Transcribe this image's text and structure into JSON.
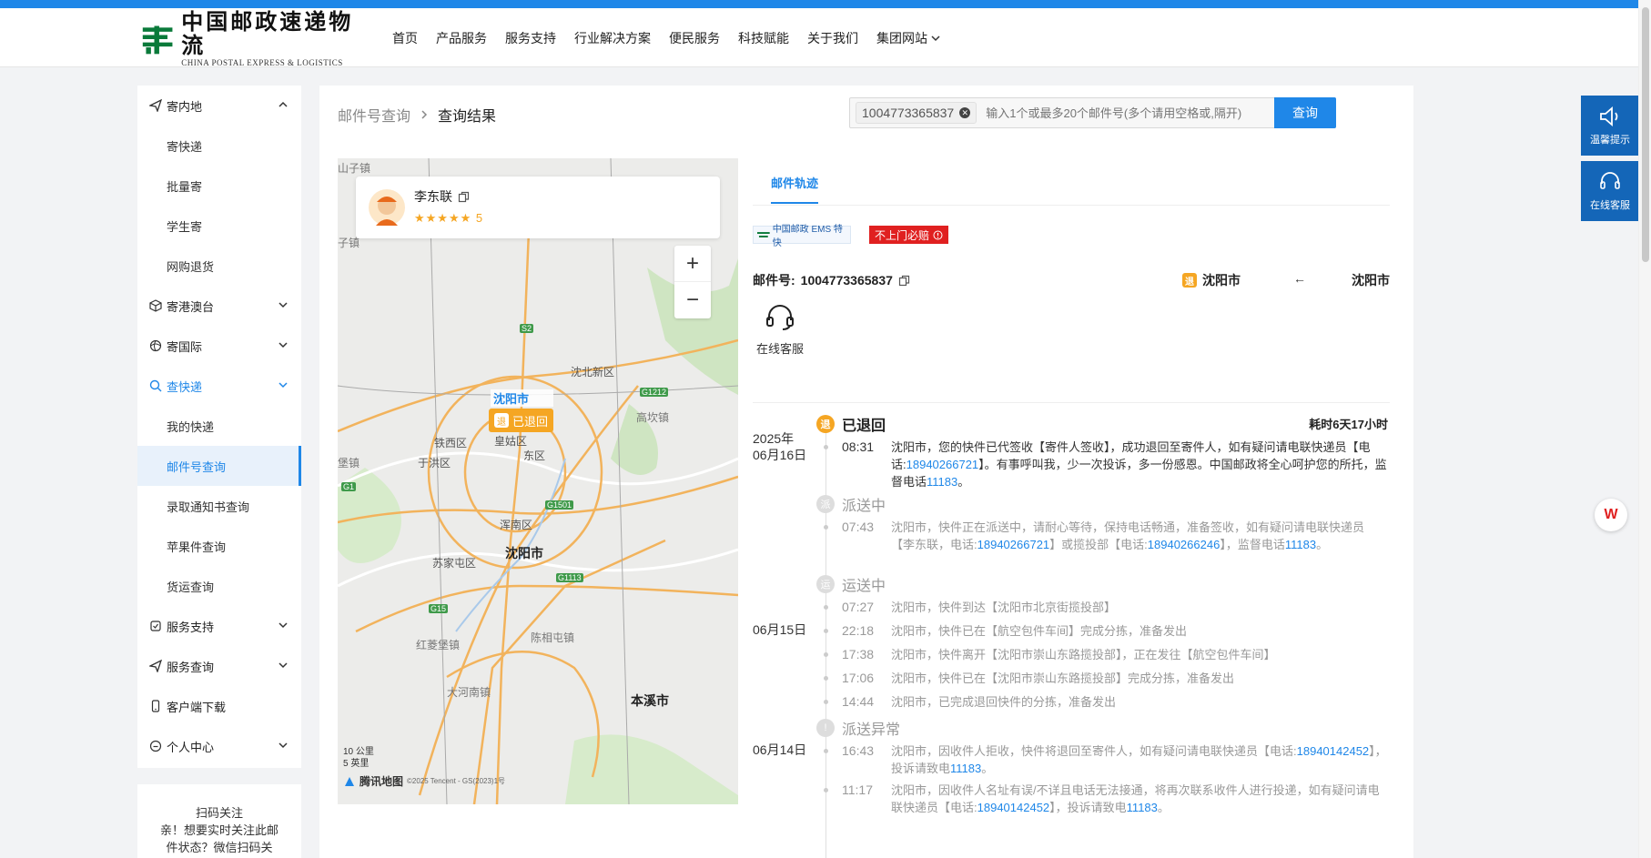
{
  "header": {
    "logo_cn": "中国邮政速递物流",
    "logo_en": "CHINA POSTAL EXPRESS & LOGISTICS",
    "nav": [
      "首页",
      "产品服务",
      "服务支持",
      "行业解决方案",
      "便民服务",
      "科技赋能",
      "关于我们",
      "集团网站"
    ]
  },
  "sidebar": {
    "sections": [
      {
        "label": "寄内地",
        "icon": "send-icon",
        "expanded": true,
        "subs": [
          "寄快递",
          "批量寄",
          "学生寄",
          "网购退货"
        ]
      },
      {
        "label": "寄港澳台",
        "icon": "box-icon",
        "expanded": false
      },
      {
        "label": "寄国际",
        "icon": "globe-icon",
        "expanded": false
      },
      {
        "label": "查快递",
        "icon": "search-icon",
        "expanded": true,
        "subs": [
          "我的快递",
          "邮件号查询",
          "录取通知书查询",
          "苹果件查询",
          "货运查询"
        ]
      },
      {
        "label": "服务支持",
        "icon": "support-icon",
        "expanded": false
      },
      {
        "label": "服务查询",
        "icon": "query-icon",
        "expanded": false
      },
      {
        "label": "客户端下载",
        "icon": "phone-icon",
        "expanded": false
      },
      {
        "label": "个人中心",
        "icon": "user-icon",
        "expanded": false
      }
    ],
    "qr_title": "扫码关注",
    "qr_text_1": "亲！想要实时关注此邮",
    "qr_text_2": "件状态？微信扫码关"
  },
  "breadcrumb": {
    "parent": "邮件号查询",
    "current": "查询结果"
  },
  "search": {
    "tag": "1004773365837",
    "placeholder": "输入1个或最多20个邮件号(多个请用空格或,隔开)",
    "button": "查询"
  },
  "map": {
    "courier_name": "李东联",
    "rating": "★★★★★ 5",
    "labels": {
      "city": "沈阳市",
      "status": "已退回",
      "district_n": "沈北新区",
      "district_w": "铁西区",
      "district_sw": "苏家屯区",
      "district_h": "浑南区",
      "district_y": "于洪区",
      "district_c": "皇姑区",
      "district_dd": "东区",
      "county_hq": "高坎镇",
      "county_hl": "红菱堡镇",
      "county_cx": "陈相屯镇",
      "county_dh": "大河南镇",
      "city_bx": "本溪市",
      "city_sy2": "沈阳市",
      "edge1": "山子镇",
      "edge2": "子镇",
      "edge3": "堡镇"
    },
    "roads": [
      "S2",
      "G1212",
      "G1",
      "G1501",
      "G1113",
      "G15"
    ],
    "scale_km": "10 公里",
    "scale_mi": "5 英里",
    "brand": "腾讯地图",
    "copyright": "©2025 Tencent - GS(2023)1号"
  },
  "track": {
    "tab": "邮件轨迹",
    "ems_badge": "中国邮政 EMS 特快",
    "guarantee": "不上门必赔",
    "mail_label": "邮件号:",
    "mail_no": "1004773365837",
    "from_city": "沈阳市",
    "to_city": "沈阳市",
    "return_badge": "退",
    "back_arrow": "←",
    "service": "在线客服",
    "elapsed": "耗时6天17小时",
    "stage_returned": "已退回",
    "stage_delivering": "派送中",
    "stage_transit": "运送中",
    "stage_exception": "派送异常",
    "stage_icons": {
      "returned": "退",
      "delivering": "派",
      "transit": "运",
      "exception": "!"
    },
    "date_year": "2025年",
    "date_0616": "06月16日",
    "date_0615": "06月15日",
    "date_0614": "06月14日",
    "events": [
      {
        "time": "08:31",
        "a": "沈阳市，您的快件已代签收【寄件人签收】，成功退回至寄件人，如有疑问请电联快递员【电话:",
        "b": "18940266721",
        "c": "】。有事呼叫我，少一次投诉，多一份感恩。中国邮政将全心呵护您的所托，监督电话",
        "d": "11183",
        "e": "。"
      },
      {
        "time": "07:43",
        "a": "沈阳市，快件正在派送中，请耐心等待，保持电话畅通，准备签收，如有疑问请电联快递员【李东联，电话:",
        "b": "18940266721",
        "c": "】或揽投部【电话:",
        "d": "18940266246",
        "e": "】，监督电话",
        "f": "11183",
        "g": "。"
      },
      {
        "time": "07:27",
        "a": "沈阳市，快件到达【沈阳市北京街揽投部】"
      },
      {
        "time": "22:18",
        "a": "沈阳市，快件已在【航空包件车间】完成分拣，准备发出"
      },
      {
        "time": "17:38",
        "a": "沈阳市，快件离开【沈阳市崇山东路揽投部】，正在发往【航空包件车间】"
      },
      {
        "time": "17:06",
        "a": "沈阳市，快件已在【沈阳市崇山东路揽投部】完成分拣，准备发出"
      },
      {
        "time": "14:44",
        "a": "沈阳市，已完成退回快件的分拣，准备发出"
      },
      {
        "time": "16:43",
        "a": "沈阳市，因收件人拒收，快件将退回至寄件人，如有疑问请电联快递员【电话:",
        "b": "18940142452",
        "c": "】，投诉请致电",
        "d": "11183",
        "e": "。"
      },
      {
        "time": "11:17",
        "a": "沈阳市，因收件人名址有误/不详且电话无法接通，将再次联系收件人进行投递，如有疑问请电联快递员【电话:",
        "b": "18940142452",
        "c": "】，投诉请致电",
        "d": "11183",
        "e": "。"
      }
    ]
  },
  "rightbar": {
    "tip": "温馨提示",
    "service": "在线客服",
    "wps": "W"
  },
  "colors": {
    "brand": "#1f87e8",
    "accent": "#f5a623",
    "alert": "#e02020",
    "dark": "#1466b8"
  }
}
